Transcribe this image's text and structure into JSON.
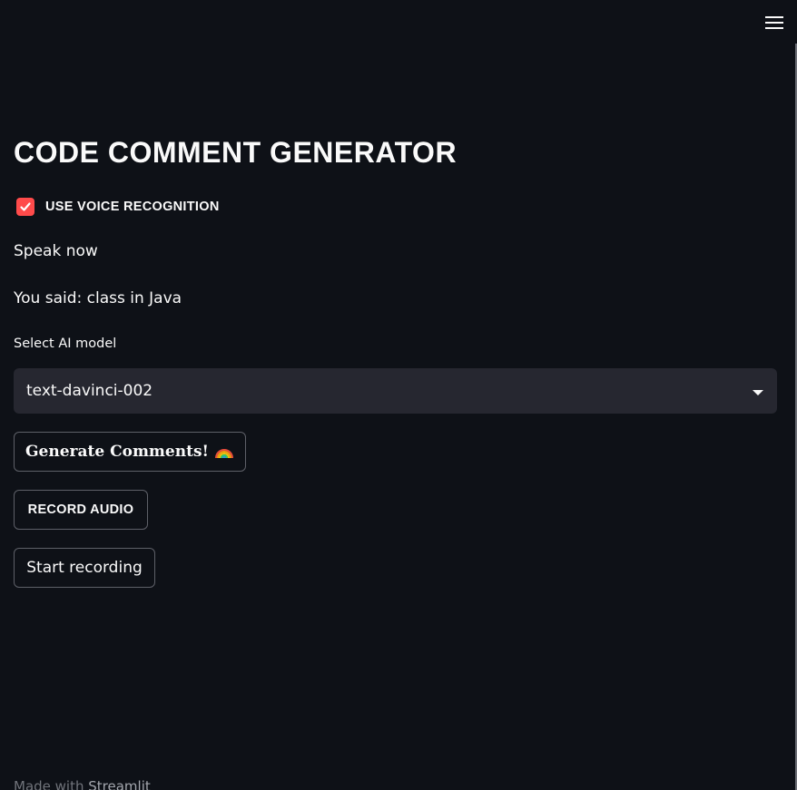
{
  "header": {
    "menu_icon": "hamburger-menu-icon"
  },
  "main": {
    "title": "CODE COMMENT GENERATOR",
    "voice_checkbox": {
      "label": "USE VOICE RECOGNITION",
      "checked": true,
      "icon": "checkmark-icon"
    },
    "speak_prompt": "Speak now",
    "you_said": "You said: class in Java",
    "model_select": {
      "label": "Select AI model",
      "value": "text-davinci-002",
      "icon": "chevron-down-icon"
    },
    "generate_button": {
      "label": "Generate Comments!",
      "icon": "rainbow-icon"
    },
    "record_button": {
      "label": "RECORD AUDIO"
    },
    "start_button": {
      "label": "Start recording"
    }
  },
  "footer": {
    "made_with": "Made with",
    "brand": "Streamlit"
  },
  "colors": {
    "background": "#0e1117",
    "accent": "#ff4b4b",
    "select_bg": "#262730",
    "border": "#5e6068",
    "text": "#fafafa"
  }
}
